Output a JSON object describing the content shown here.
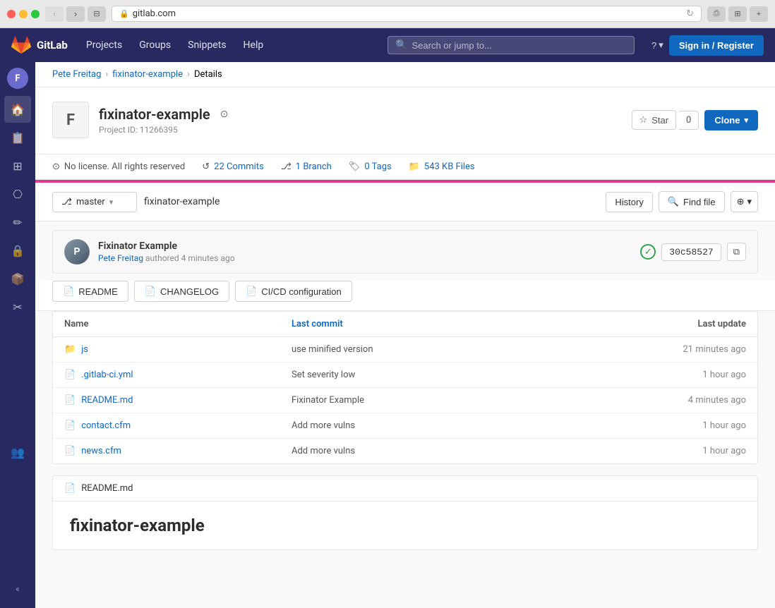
{
  "browser": {
    "url": "gitlab.com",
    "lock_icon": "🔒"
  },
  "navbar": {
    "brand": "GitLab",
    "projects": "Projects",
    "groups": "Groups",
    "snippets": "Snippets",
    "help": "Help",
    "search_placeholder": "Search or jump to...",
    "sign_in": "Sign in / Register"
  },
  "breadcrumb": {
    "user": "Pete Freitag",
    "repo": "fixinator-example",
    "current": "Details"
  },
  "project": {
    "name": "fixinator-example",
    "avatar_letter": "F",
    "id_label": "Project ID: 11266395",
    "star_label": "Star",
    "star_count": "0",
    "clone_label": "Clone"
  },
  "stats": {
    "license": "No license. All rights reserved",
    "commits": "22 Commits",
    "branches": "1 Branch",
    "tags": "0 Tags",
    "files": "543 KB Files"
  },
  "repo_controls": {
    "branch": "master",
    "path": "fixinator-example",
    "history": "History",
    "find_file": "Find file"
  },
  "commit": {
    "message": "Fixinator Example",
    "author": "Pete Freitag",
    "meta": "authored 4 minutes ago",
    "hash": "30c58527",
    "copy_icon": "⧉"
  },
  "quick_links": [
    {
      "label": "README",
      "icon": "📄"
    },
    {
      "label": "CHANGELOG",
      "icon": "📄"
    },
    {
      "label": "CI/CD configuration",
      "icon": "📄"
    }
  ],
  "file_table": {
    "col_name": "Name",
    "col_commit": "Last commit",
    "col_update": "Last update",
    "rows": [
      {
        "name": "js",
        "type": "folder",
        "commit": "use minified version",
        "update": "21 minutes ago"
      },
      {
        "name": ".gitlab-ci.yml",
        "type": "file",
        "commit": "Set severity low",
        "update": "1 hour ago"
      },
      {
        "name": "README.md",
        "type": "file",
        "commit": "Fixinator Example",
        "update": "4 minutes ago"
      },
      {
        "name": "contact.cfm",
        "type": "file",
        "commit": "Add more vulns",
        "update": "1 hour ago"
      },
      {
        "name": "news.cfm",
        "type": "file",
        "commit": "Add more vulns",
        "update": "1 hour ago"
      }
    ]
  },
  "readme": {
    "header": "README.md",
    "title": "fixinator-example"
  },
  "sidebar_icons": [
    "🏠",
    "📋",
    "⊞",
    "⎔",
    "✏",
    "🔒",
    "📦",
    "✂",
    "👥"
  ],
  "user_avatar": "F"
}
